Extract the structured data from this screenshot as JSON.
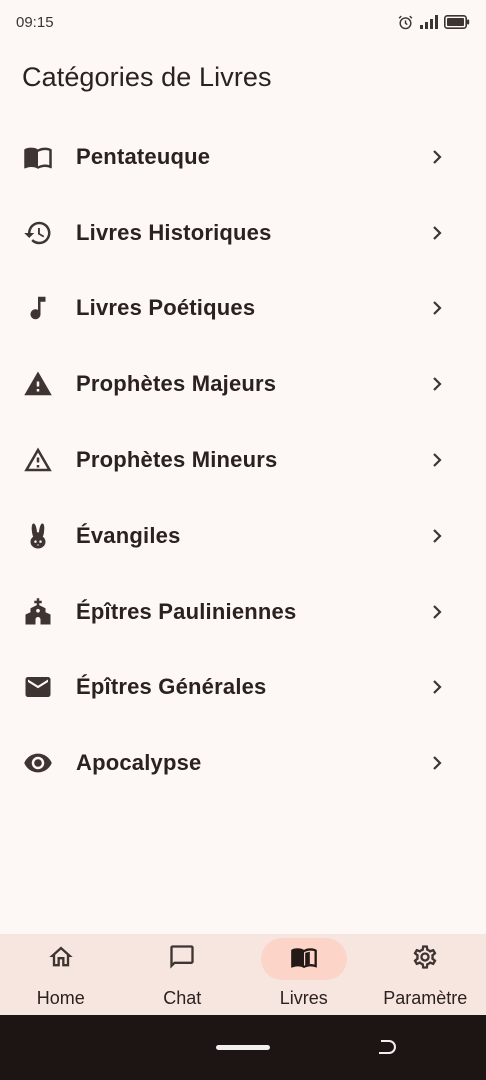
{
  "status_bar": {
    "time": "09:15",
    "icons": [
      "alarm-icon",
      "signal-icon",
      "battery-icon"
    ]
  },
  "page": {
    "title": "Catégories de Livres"
  },
  "categories": [
    {
      "label": "Pentateuque",
      "icon": "book-open-icon"
    },
    {
      "label": "Livres Historiques",
      "icon": "history-icon"
    },
    {
      "label": "Livres Poétiques",
      "icon": "music-note-icon"
    },
    {
      "label": "Prophètes Majeurs",
      "icon": "warning-filled-icon"
    },
    {
      "label": "Prophètes Mineurs",
      "icon": "warning-outline-icon"
    },
    {
      "label": "Évangiles",
      "icon": "rabbit-icon"
    },
    {
      "label": "Épîtres Pauliniennes",
      "icon": "church-icon"
    },
    {
      "label": "Épîtres Générales",
      "icon": "mail-icon"
    },
    {
      "label": "Apocalypse",
      "icon": "eye-icon"
    }
  ],
  "bottom_nav": {
    "items": [
      {
        "label": "Home",
        "icon": "home-icon",
        "active": false
      },
      {
        "label": "Chat",
        "icon": "chat-icon",
        "active": false
      },
      {
        "label": "Livres",
        "icon": "book-icon",
        "active": true
      },
      {
        "label": "Paramètre",
        "icon": "gear-icon",
        "active": false
      }
    ]
  },
  "colors": {
    "background": "#fdf7f5",
    "nav_background": "#f7e6e0",
    "active_pill": "#fdd5c8",
    "text": "#2a2120",
    "icon": "#3e3432",
    "system_bar": "#1c1513"
  }
}
